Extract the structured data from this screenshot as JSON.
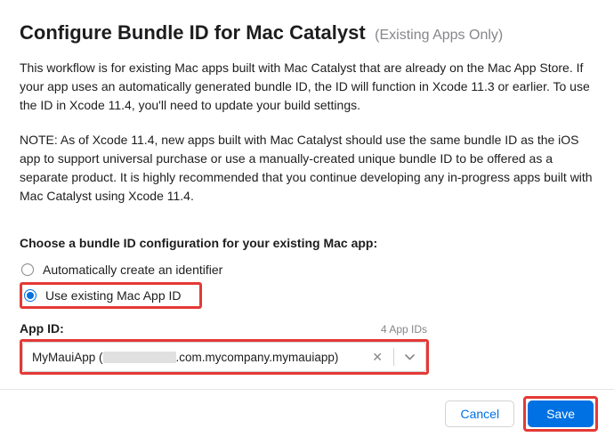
{
  "header": {
    "title": "Configure Bundle ID for Mac Catalyst",
    "subtitle": "(Existing Apps Only)"
  },
  "paragraphs": {
    "p1": "This workflow is for existing Mac apps built with Mac Catalyst that are already on the Mac App Store. If your app uses an automatically generated bundle ID, the ID will function in Xcode 11.3 or earlier. To use the ID in Xcode 11.4, you'll need to update your build settings.",
    "p2": "NOTE: As of Xcode 11.4, new apps built with Mac Catalyst should use the same bundle ID as the iOS app to support universal purchase or use a manually-created unique bundle ID to be offered as a separate product. It is highly recommended that you continue developing any in-progress apps built with Mac Catalyst using Xcode 11.4."
  },
  "choose": {
    "label": "Choose a bundle ID configuration for your existing Mac app:",
    "options": {
      "auto": "Automatically create an identifier",
      "existing": "Use existing Mac App ID"
    }
  },
  "appId": {
    "label": "App ID:",
    "count": "4 App IDs",
    "value_prefix": "MyMauiApp (",
    "value_suffix": ".com.mycompany.mymauiapp)"
  },
  "footer": {
    "cancel": "Cancel",
    "save": "Save"
  }
}
